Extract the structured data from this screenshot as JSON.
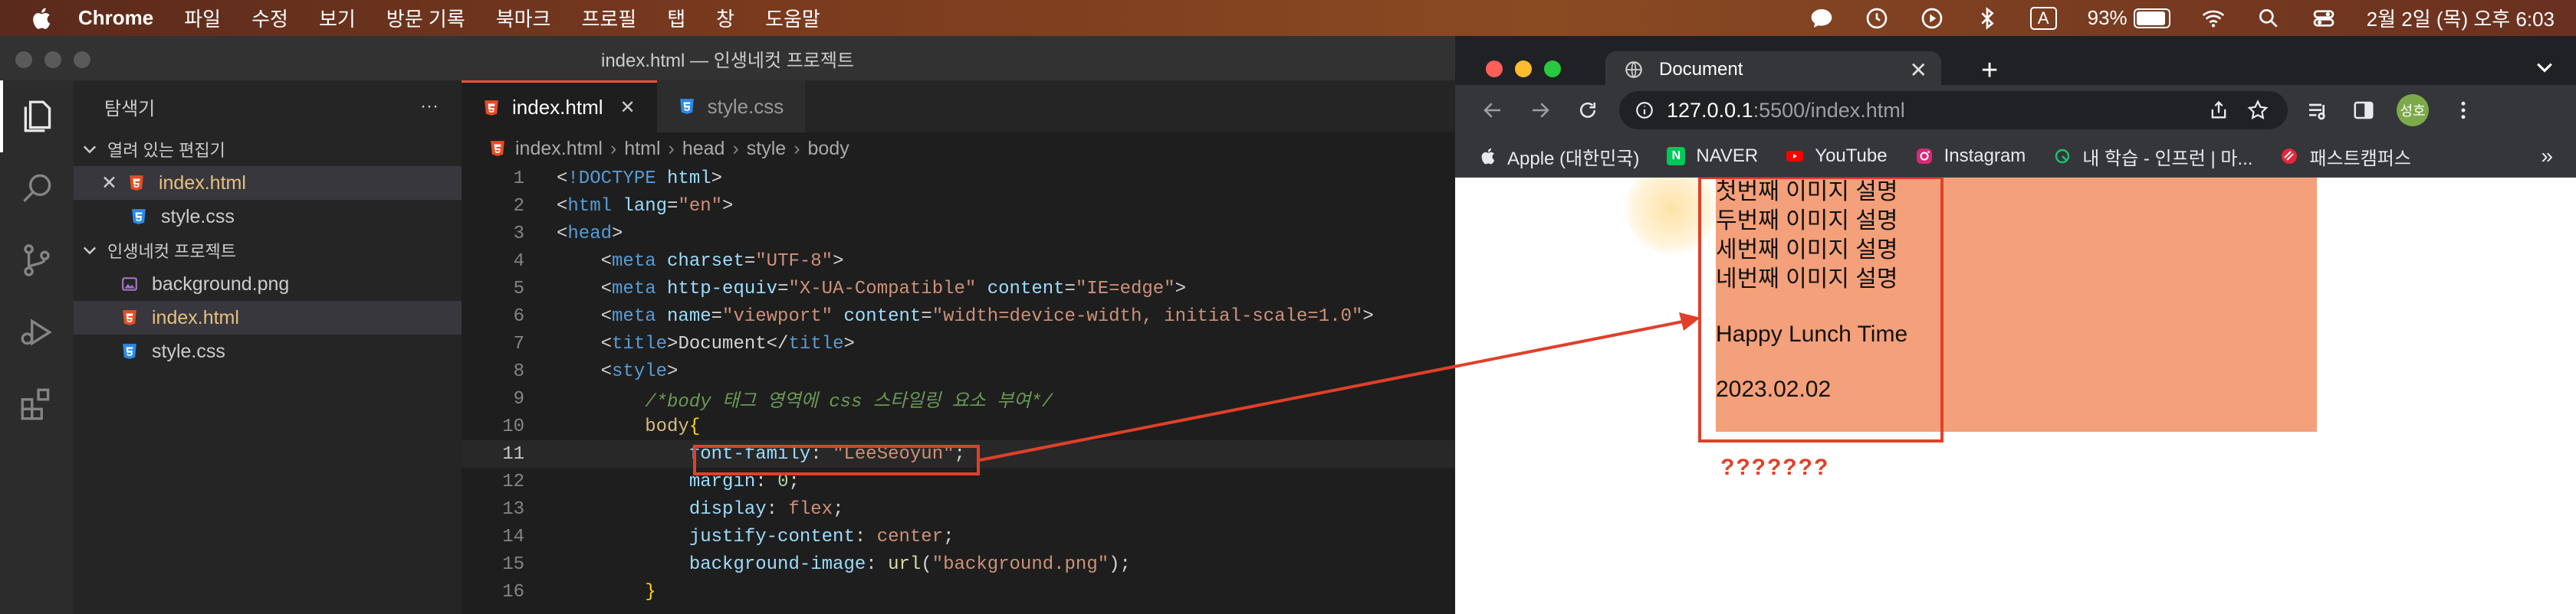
{
  "menubar": {
    "app": "Chrome",
    "items": [
      "파일",
      "수정",
      "보기",
      "방문 기록",
      "북마크",
      "프로필",
      "탭",
      "창",
      "도움말"
    ],
    "input_badge": "A",
    "battery": "93%",
    "battery_level": 0.93,
    "datetime": "2월 2일 (목) 오후 6:03"
  },
  "vscode": {
    "title": "index.html — 인생네컷 프로젝트",
    "explorer_title": "탐색기",
    "more_label": "···",
    "open_editors_label": "열려 있는 편집기",
    "open_editors": [
      "index.html",
      "style.css"
    ],
    "close_mark": "✕",
    "project_label": "인생네컷 프로젝트",
    "files": [
      "background.png",
      "index.html",
      "style.css"
    ],
    "tabs": [
      {
        "label": "index.html"
      },
      {
        "label": "style.css"
      }
    ],
    "breadcrumbs": [
      "index.html",
      "html",
      "head",
      "style",
      "body"
    ],
    "code_lines": [
      {
        "n": "1",
        "html": "<span class='t-punc'>&lt;</span><span class='t-doct'>!DOCTYPE</span> <span class='t-attr'>html</span><span class='t-punc'>&gt;</span>"
      },
      {
        "n": "2",
        "html": "<span class='t-punc'>&lt;</span><span class='t-tag'>html</span> <span class='t-attr'>lang</span><span class='t-punc'>=</span><span class='t-str'>\"en\"</span><span class='t-punc'>&gt;</span>"
      },
      {
        "n": "3",
        "html": "<span class='t-punc'>&lt;</span><span class='t-tag'>head</span><span class='t-punc'>&gt;</span>"
      },
      {
        "n": "4",
        "html": "    <span class='t-punc'>&lt;</span><span class='t-tag'>meta</span> <span class='t-attr'>charset</span><span class='t-punc'>=</span><span class='t-str'>\"UTF-8\"</span><span class='t-punc'>&gt;</span>"
      },
      {
        "n": "5",
        "html": "    <span class='t-punc'>&lt;</span><span class='t-tag'>meta</span> <span class='t-attr'>http-equiv</span><span class='t-punc'>=</span><span class='t-str'>\"X-UA-Compatible\"</span> <span class='t-attr'>content</span><span class='t-punc'>=</span><span class='t-str'>\"IE=edge\"</span><span class='t-punc'>&gt;</span>"
      },
      {
        "n": "6",
        "html": "    <span class='t-punc'>&lt;</span><span class='t-tag'>meta</span> <span class='t-attr'>name</span><span class='t-punc'>=</span><span class='t-str'>\"viewport\"</span> <span class='t-attr'>content</span><span class='t-punc'>=</span><span class='t-str'>\"width=device-width, initial-scale=1.0\"</span><span class='t-punc'>&gt;</span>"
      },
      {
        "n": "7",
        "html": "    <span class='t-punc'>&lt;</span><span class='t-tag'>title</span><span class='t-punc'>&gt;</span><span class='t-txt'>Document</span><span class='t-punc'>&lt;/</span><span class='t-tag'>title</span><span class='t-punc'>&gt;</span>"
      },
      {
        "n": "8",
        "html": "    <span class='t-punc'>&lt;</span><span class='t-tag'>style</span><span class='t-punc'>&gt;</span>"
      },
      {
        "n": "9",
        "html": "        <span class='t-cmt'>/*body 태그 영역에 css 스타일링 요소 부여*/</span>"
      },
      {
        "n": "10",
        "html": "        <span class='t-sel'>body</span><span class='t-br'>{</span>"
      },
      {
        "n": "11",
        "html": "            <span class='t-prop'>font-family</span><span class='t-punc'>: </span><span class='t-val'>\"LeeSeoyun\"</span><span class='t-punc'>;</span>"
      },
      {
        "n": "12",
        "html": "            <span class='t-prop'>margin</span><span class='t-punc'>: </span><span class='t-num'>0</span><span class='t-punc'>;</span>"
      },
      {
        "n": "13",
        "html": "            <span class='t-prop'>display</span><span class='t-punc'>: </span><span class='t-val'>flex</span><span class='t-punc'>;</span>"
      },
      {
        "n": "14",
        "html": "            <span class='t-prop'>justify-content</span><span class='t-punc'>: </span><span class='t-val'>center</span><span class='t-punc'>;</span>"
      },
      {
        "n": "15",
        "html": "            <span class='t-prop'>background-image</span><span class='t-punc'>: </span><span class='t-kw'>url</span><span class='t-punc'>(</span><span class='t-val'>\"background.png\"</span><span class='t-punc'>);</span>"
      },
      {
        "n": "16",
        "html": "        <span class='t-br'>}</span>"
      }
    ]
  },
  "chrome": {
    "tab_title": "Document",
    "tab_close": "✕",
    "new_tab": "+",
    "url_host": "127.0.0.1",
    "url_rest": ":5500/index.html",
    "profile": "성호",
    "bookmarks": [
      "Apple (대한민국)",
      "NAVER",
      "YouTube",
      "Instagram",
      "내 학습 - 인프런 | 마...",
      "패스트캠퍼스"
    ],
    "bookmarks_more": "»",
    "page": {
      "lines": [
        "첫번째 이미지 설명",
        "두번째 이미지 설명",
        "세번째 이미지 설명",
        "네번째 이미지 설명"
      ],
      "lunch": "Happy Lunch Time",
      "date": "2023.02.02",
      "question": "???????"
    }
  },
  "colors": {
    "accent_red": "#e0402a",
    "salmon": "#f4a07a",
    "naver": "#03c75a",
    "youtube": "#ff0000"
  }
}
